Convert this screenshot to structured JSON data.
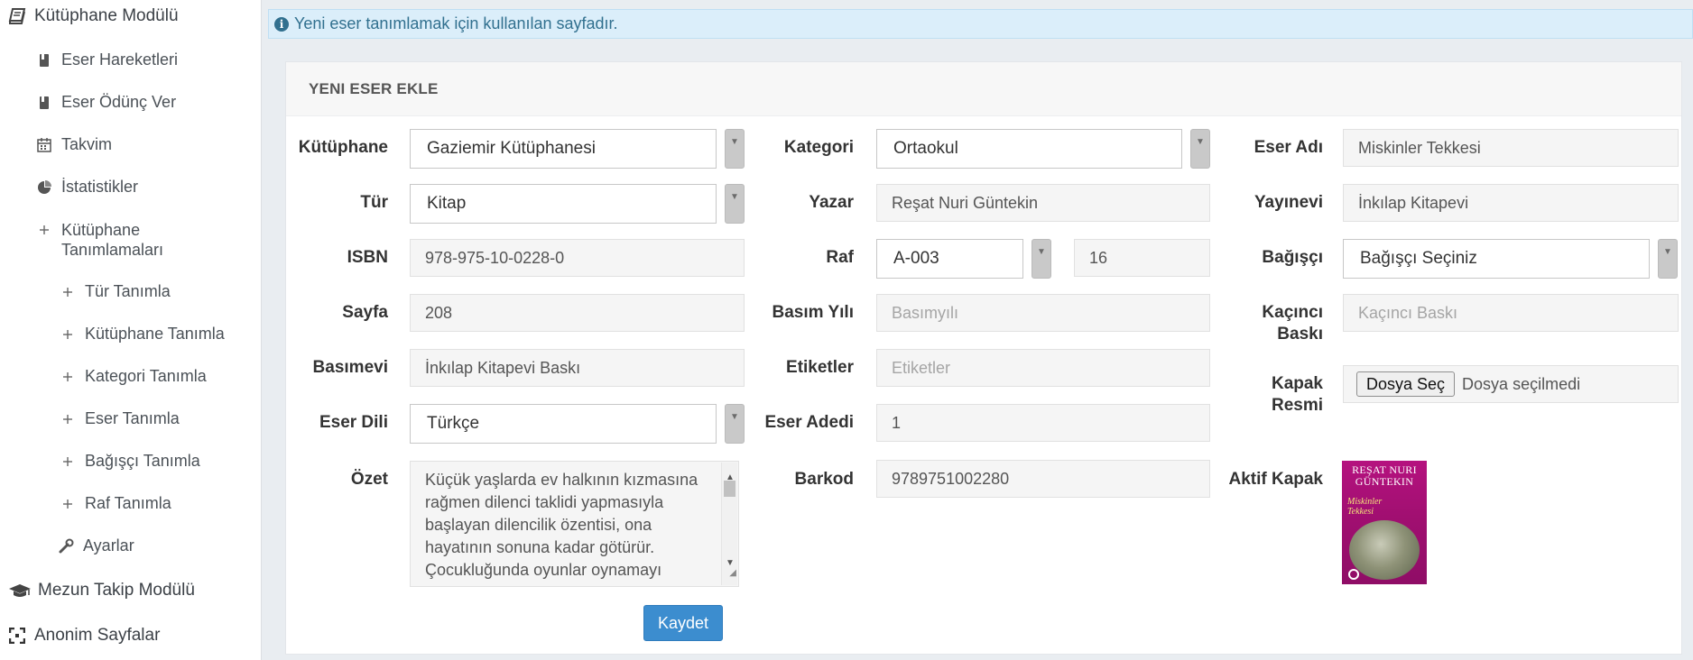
{
  "sidebar": {
    "items": [
      {
        "label": "Kütüphane Modülü",
        "icon": "book-icon"
      },
      {
        "label": "Eser Hareketleri",
        "icon": "bookmark-book-icon"
      },
      {
        "label": "Eser Ödünç Ver",
        "icon": "bookmark-book-icon"
      },
      {
        "label": "Takvim",
        "icon": "calendar-icon"
      },
      {
        "label": "İstatistikler",
        "icon": "pie-chart-icon"
      },
      {
        "label": "Kütüphane Tanımlamaları",
        "icon": "plus-icon"
      },
      {
        "label": "Tür Tanımla",
        "icon": "plus-icon"
      },
      {
        "label": "Kütüphane Tanımla",
        "icon": "plus-icon"
      },
      {
        "label": "Kategori Tanımla",
        "icon": "plus-icon"
      },
      {
        "label": "Eser Tanımla",
        "icon": "plus-icon"
      },
      {
        "label": "Bağışçı Tanımla",
        "icon": "plus-icon"
      },
      {
        "label": "Raf Tanımla",
        "icon": "plus-icon"
      },
      {
        "label": "Ayarlar",
        "icon": "wrench-icon"
      },
      {
        "label": "Mezun Takip Modülü",
        "icon": "graduation-cap-icon"
      },
      {
        "label": "Anonim Sayfalar",
        "icon": "expand-icon"
      }
    ]
  },
  "alert": {
    "text": "Yeni eser tanımlamak için kullanılan sayfadır.",
    "icon": "info-icon"
  },
  "panel": {
    "title": "YENI ESER EKLE"
  },
  "form": {
    "kutuphane": {
      "label": "Kütüphane",
      "value": "Gaziemir Kütüphanesi"
    },
    "kategori": {
      "label": "Kategori",
      "value": "Ortaokul"
    },
    "eser_adi": {
      "label": "Eser Adı",
      "value": "Miskinler Tekkesi"
    },
    "tur": {
      "label": "Tür",
      "value": "Kitap"
    },
    "yazar": {
      "label": "Yazar",
      "value": "Reşat Nuri Güntekin"
    },
    "yayinevi": {
      "label": "Yayınevi",
      "value": "İnkılap Kitapevi"
    },
    "isbn": {
      "label": "ISBN",
      "value": "978-975-10-0228-0"
    },
    "raf": {
      "label": "Raf",
      "value": "A-003",
      "number": "16"
    },
    "bagisci": {
      "label": "Bağışçı",
      "value": "Bağışçı Seçiniz"
    },
    "sayfa": {
      "label": "Sayfa",
      "value": "208"
    },
    "basim_yili": {
      "label": "Basım Yılı",
      "placeholder": "Basımyılı"
    },
    "kacinci_baski": {
      "label_line1": "Kaçıncı",
      "label_line2": "Baskı",
      "placeholder": "Kaçıncı Baskı"
    },
    "basimevi": {
      "label": "Basımevi",
      "value": "İnkılap Kitapevi Baskı"
    },
    "etiketler": {
      "label": "Etiketler",
      "placeholder": "Etiketler"
    },
    "kapak_resmi": {
      "label_line1": "Kapak",
      "label_line2": "Resmi",
      "button": "Dosya Seç",
      "status": "Dosya seçilmedi"
    },
    "eser_dili": {
      "label": "Eser Dili",
      "value": "Türkçe"
    },
    "eser_adedi": {
      "label": "Eser Adedi",
      "value": "1"
    },
    "ozet": {
      "label": "Özet",
      "lines": [
        "Küçük yaşlarda ev halkının kızmasına",
        "rağmen dilenci taklidi yapmasıyla",
        "başlayan dilencilik özentisi, ona",
        "hayatının sonuna kadar götürür.",
        "Çocukluğunda oyunlar oynamayı"
      ]
    },
    "barkod": {
      "label": "Barkod",
      "value": "9789751002280"
    },
    "aktif_kapak": {
      "label": "Aktif Kapak",
      "cover_author_line1": "REŞAT NURI",
      "cover_author_line2": "GÜNTEKIN",
      "cover_title_line1": "Miskinler",
      "cover_title_line2": "Tekkesi"
    }
  },
  "actions": {
    "save": "Kaydet"
  },
  "colors": {
    "save_button": "#3c8dcf",
    "alert_bg": "#dbeefa",
    "alert_text": "#31708f",
    "cover": "#a10f71"
  }
}
